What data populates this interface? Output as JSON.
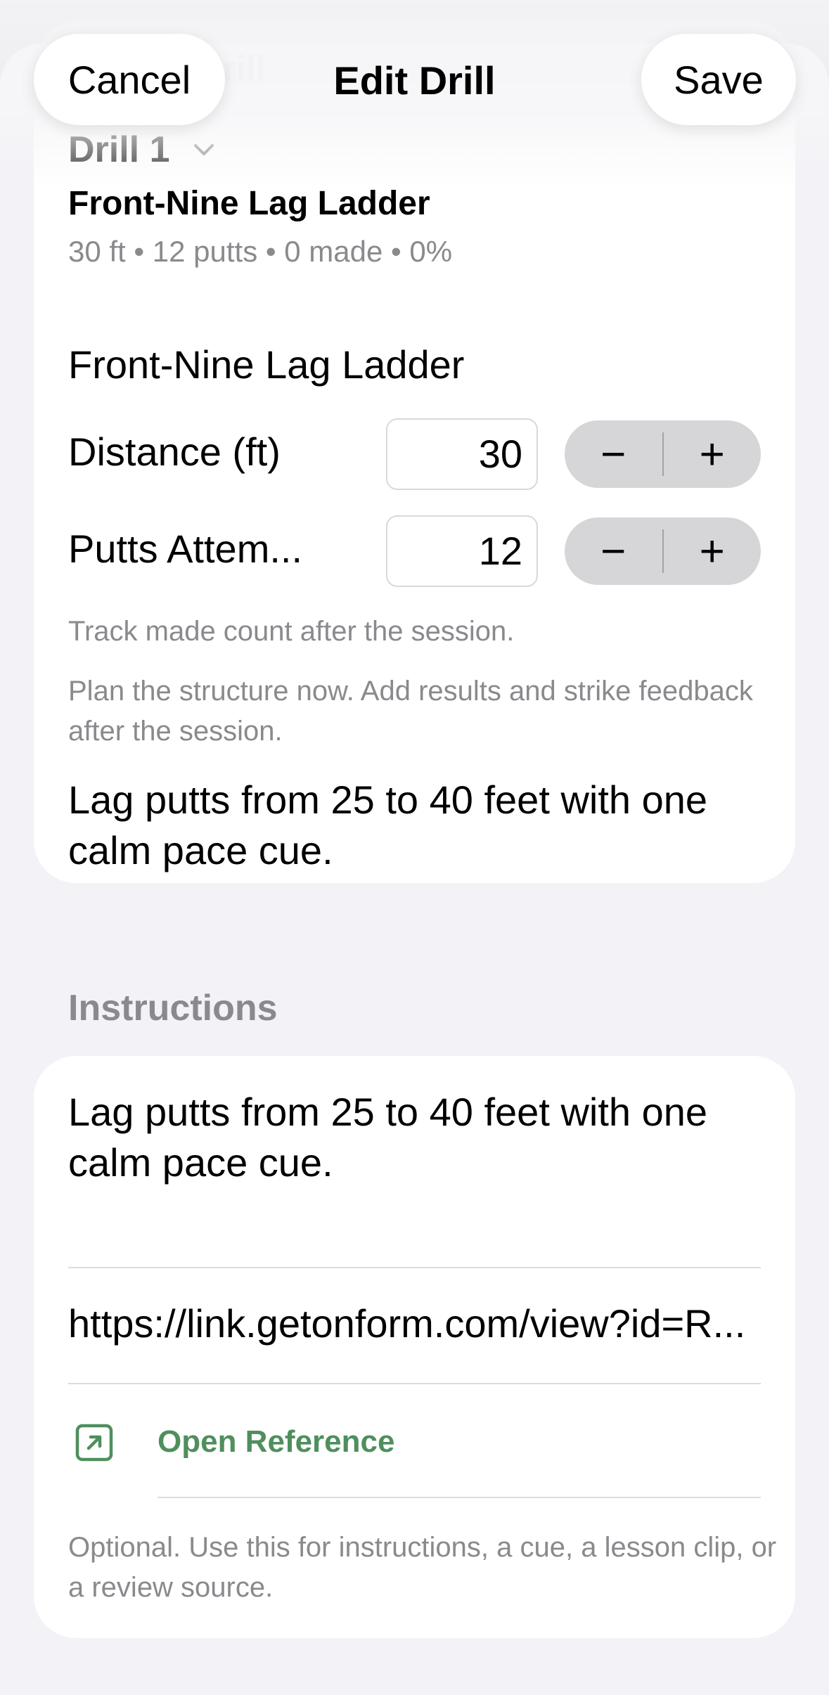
{
  "nav": {
    "cancel_label": "Cancel",
    "title": "Edit Drill",
    "save_label": "Save",
    "ghost_title": "Default Drill"
  },
  "drill_card": {
    "selector_label": "Drill 1",
    "name": "Front-Nine Lag Ladder",
    "meta": "30 ft • 12 putts • 0 made • 0%",
    "name_field_value": "Front-Nine Lag Ladder",
    "distance": {
      "label": "Distance (ft)",
      "value": "30",
      "minus": "−",
      "plus": "+"
    },
    "putts": {
      "label": "Putts Attem...",
      "value": "12",
      "minus": "−",
      "plus": "+"
    },
    "track_note": "Track made count after the session.",
    "plan_note": "Plan the structure now. Add results and strike feedback after the session.",
    "description": "Lag putts from 25 to 40 feet with one calm pace cue."
  },
  "instructions": {
    "header": "Instructions",
    "text": "Lag putts from 25 to 40 feet with one calm pace cue.",
    "url": "https://link.getonform.com/view?id=R...",
    "open_reference_label": "Open Reference",
    "open_reference_icon": "arrow-up-right-square-icon",
    "footer_note": "Optional. Use this for instructions, a cue, a lesson clip, or a review source."
  },
  "colors": {
    "accent_green": "#4f8f5d",
    "secondary_text": "#8a8a8e",
    "background": "#f2f2f7"
  }
}
